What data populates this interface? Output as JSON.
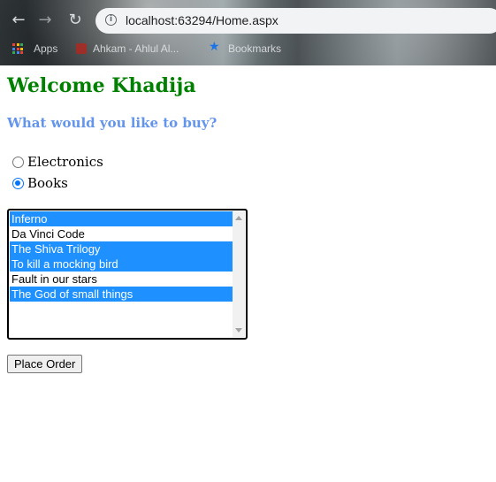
{
  "browser": {
    "url": "localhost:63294/Home.aspx",
    "bookmarks": {
      "apps_label": "Apps",
      "items": [
        "Ahkam - Ahlul Al...",
        "Bookmarks"
      ]
    },
    "icons": {
      "back": "back-arrow-icon",
      "forward": "forward-arrow-icon",
      "reload": "reload-icon",
      "site_info": "info-icon",
      "apps": "apps-grid-icon",
      "bookmark": "star-icon"
    }
  },
  "page": {
    "welcome": "Welcome Khadija",
    "question": "What would you like to buy?",
    "categories": [
      {
        "label": "Electronics",
        "checked": false
      },
      {
        "label": "Books",
        "checked": true
      }
    ],
    "products": [
      {
        "label": "Inferno",
        "selected": true
      },
      {
        "label": "Da Vinci Code",
        "selected": false
      },
      {
        "label": "The Shiva Trilogy",
        "selected": true
      },
      {
        "label": "To kill a mocking bird",
        "selected": true
      },
      {
        "label": "Fault in our stars",
        "selected": false
      },
      {
        "label": "The God of small things",
        "selected": true
      }
    ],
    "order_button": "Place Order"
  },
  "colors": {
    "welcome": "#008000",
    "question": "#6495ed",
    "selection": "#1e90ff",
    "radio_checked": "#0075ff"
  }
}
